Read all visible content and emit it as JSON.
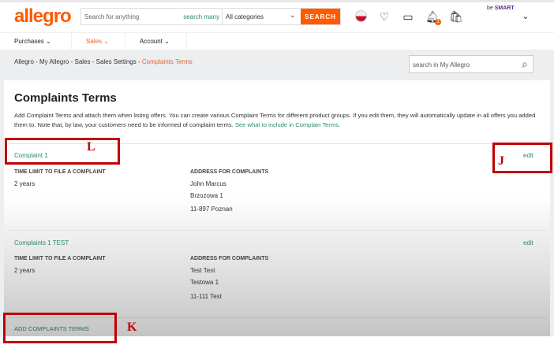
{
  "header": {
    "logo": "allegro",
    "search_placeholder": "Search for anything",
    "search_many": "search many",
    "category": "All categories",
    "search_button": "SEARCH",
    "notification_count": "1",
    "smart_prefix": "be",
    "smart": "SMART"
  },
  "nav": [
    {
      "label": "Purchases"
    },
    {
      "label": "Sales"
    },
    {
      "label": "Account"
    }
  ],
  "breadcrumb": [
    "Allegro",
    "My Allegro",
    "Sales",
    "Sales Settings",
    "Complaints Terms"
  ],
  "my_search_placeholder": "search in My Allegro",
  "page": {
    "title": "Complaints Terms",
    "description": "Add Complaint Terms and attach them when listing offers. You can create various Complaint Terms for different product groups. If you edit them, they will automatically update in all offers you added them to. Note that, by law, your customers need to be informed of complaint terms.",
    "link": "See what to include in Complain Terms."
  },
  "terms": [
    {
      "name": "Complaint 1",
      "edit": "edit",
      "time_label": "TIME LIMIT TO FILE A COMPLAINT",
      "time": "2 years",
      "address_label": "ADDRESS FOR COMPLAINTS",
      "address": [
        "John Marcus",
        "Brzozowa 1",
        "11-897 Poznan"
      ]
    },
    {
      "name": "Complaints 1 TEST",
      "edit": "edit",
      "time_label": "TIME LIMIT TO FILE A COMPLAINT",
      "time": "2 years",
      "address_label": "ADDRESS FOR COMPLAINTS",
      "address": [
        "Test Test",
        "Testowa 1",
        "11-111 Test"
      ]
    }
  ],
  "add_button": "ADD COMPLAINTS TERMS",
  "annotations": {
    "L": "L",
    "J": "J",
    "K": "K"
  },
  "colors": {
    "brand": "#ff5a00",
    "link": "#2a8a6e",
    "annotation": "#c00000"
  }
}
